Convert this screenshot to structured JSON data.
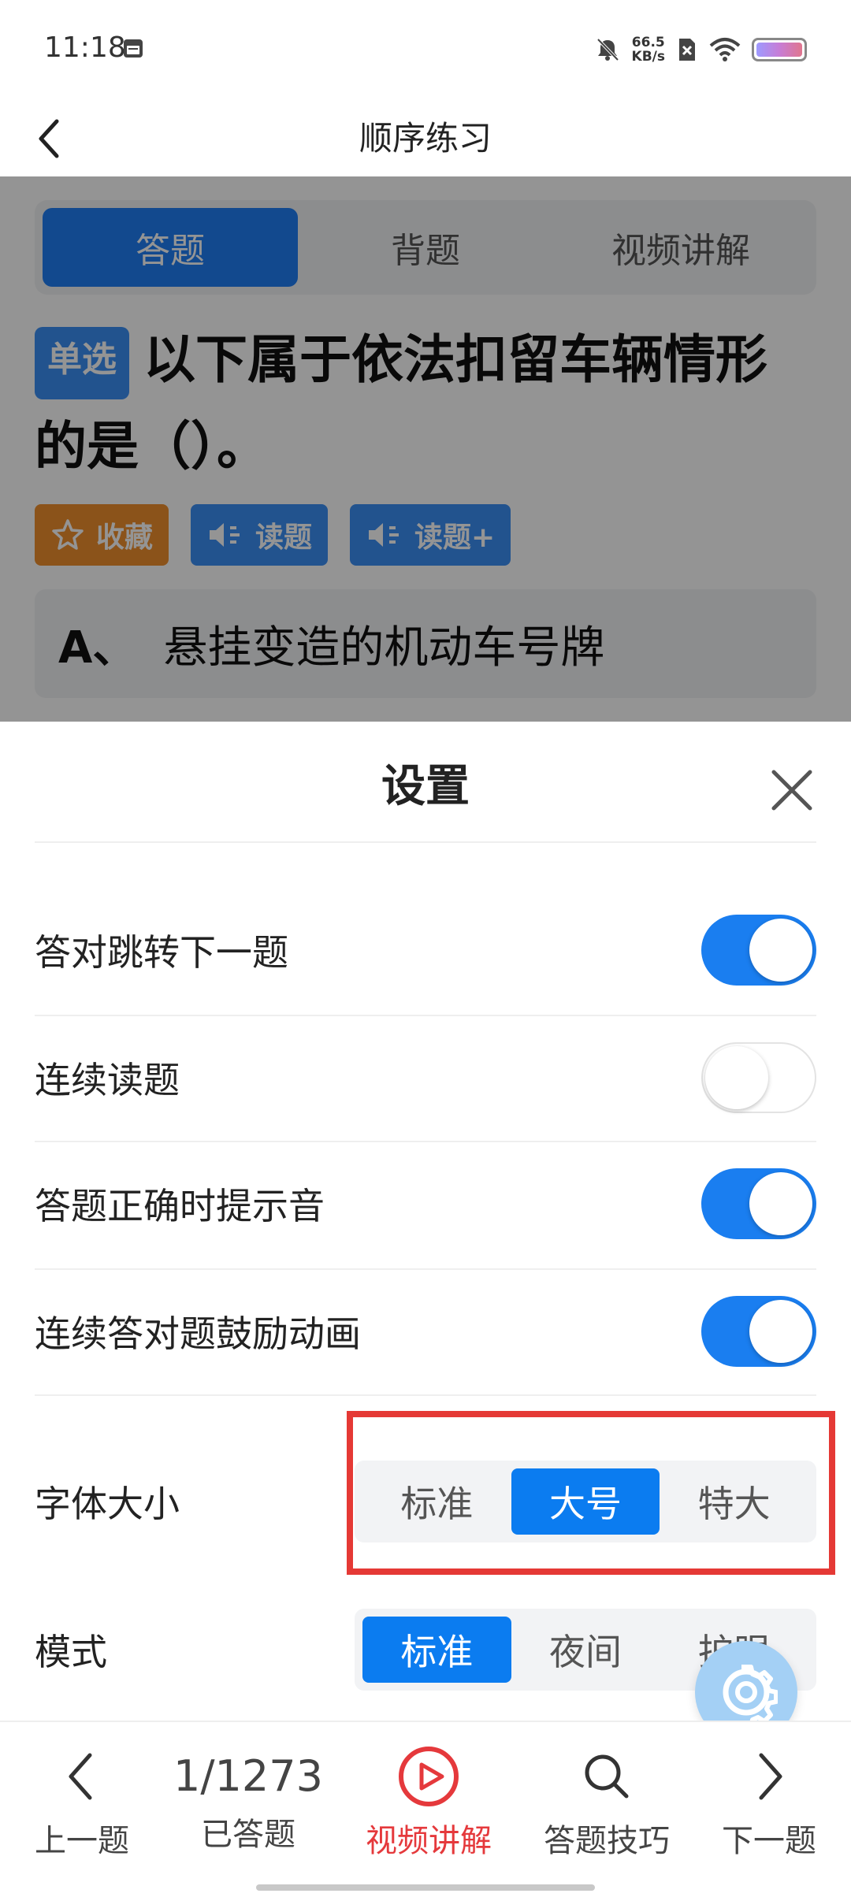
{
  "status_bar": {
    "time": "11:18",
    "net_speed_value": "66.5",
    "net_speed_unit": "KB/s"
  },
  "header": {
    "title": "顺序练习"
  },
  "mode_tabs": [
    {
      "label": "答题",
      "active": true
    },
    {
      "label": "背题",
      "active": false
    },
    {
      "label": "视频讲解",
      "active": false
    }
  ],
  "question": {
    "type_badge": "单选",
    "text": "以下属于依法扣留车辆情形的是（）。",
    "actions": {
      "favorite": "收藏",
      "read": "读题",
      "read_plus": "读题+"
    },
    "option_a": {
      "letter": "A、",
      "text": "悬挂变造的机动车号牌"
    }
  },
  "settings": {
    "title": "设置",
    "rows": [
      {
        "label": "答对跳转下一题",
        "enabled": true
      },
      {
        "label": "连续读题",
        "enabled": false
      },
      {
        "label": "答题正确时提示音",
        "enabled": true
      },
      {
        "label": "连续答对题鼓励动画",
        "enabled": true
      }
    ],
    "font_size": {
      "label": "字体大小",
      "options": [
        "标准",
        "大号",
        "特大"
      ],
      "selected": "大号"
    },
    "mode": {
      "label": "模式",
      "options": [
        "标准",
        "夜间",
        "护眼"
      ],
      "selected": "标准"
    }
  },
  "bottom_nav": {
    "prev_label": "上一题",
    "progress": "1/1273",
    "answered_label": "已答题",
    "video_label": "视频讲解",
    "tips_label": "答题技巧",
    "next_label": "下一题"
  },
  "colors": {
    "primary_blue": "#1a7ef0",
    "favorite_orange": "#f0902d",
    "active_red": "#e5393c",
    "highlight_red": "#e53935"
  }
}
